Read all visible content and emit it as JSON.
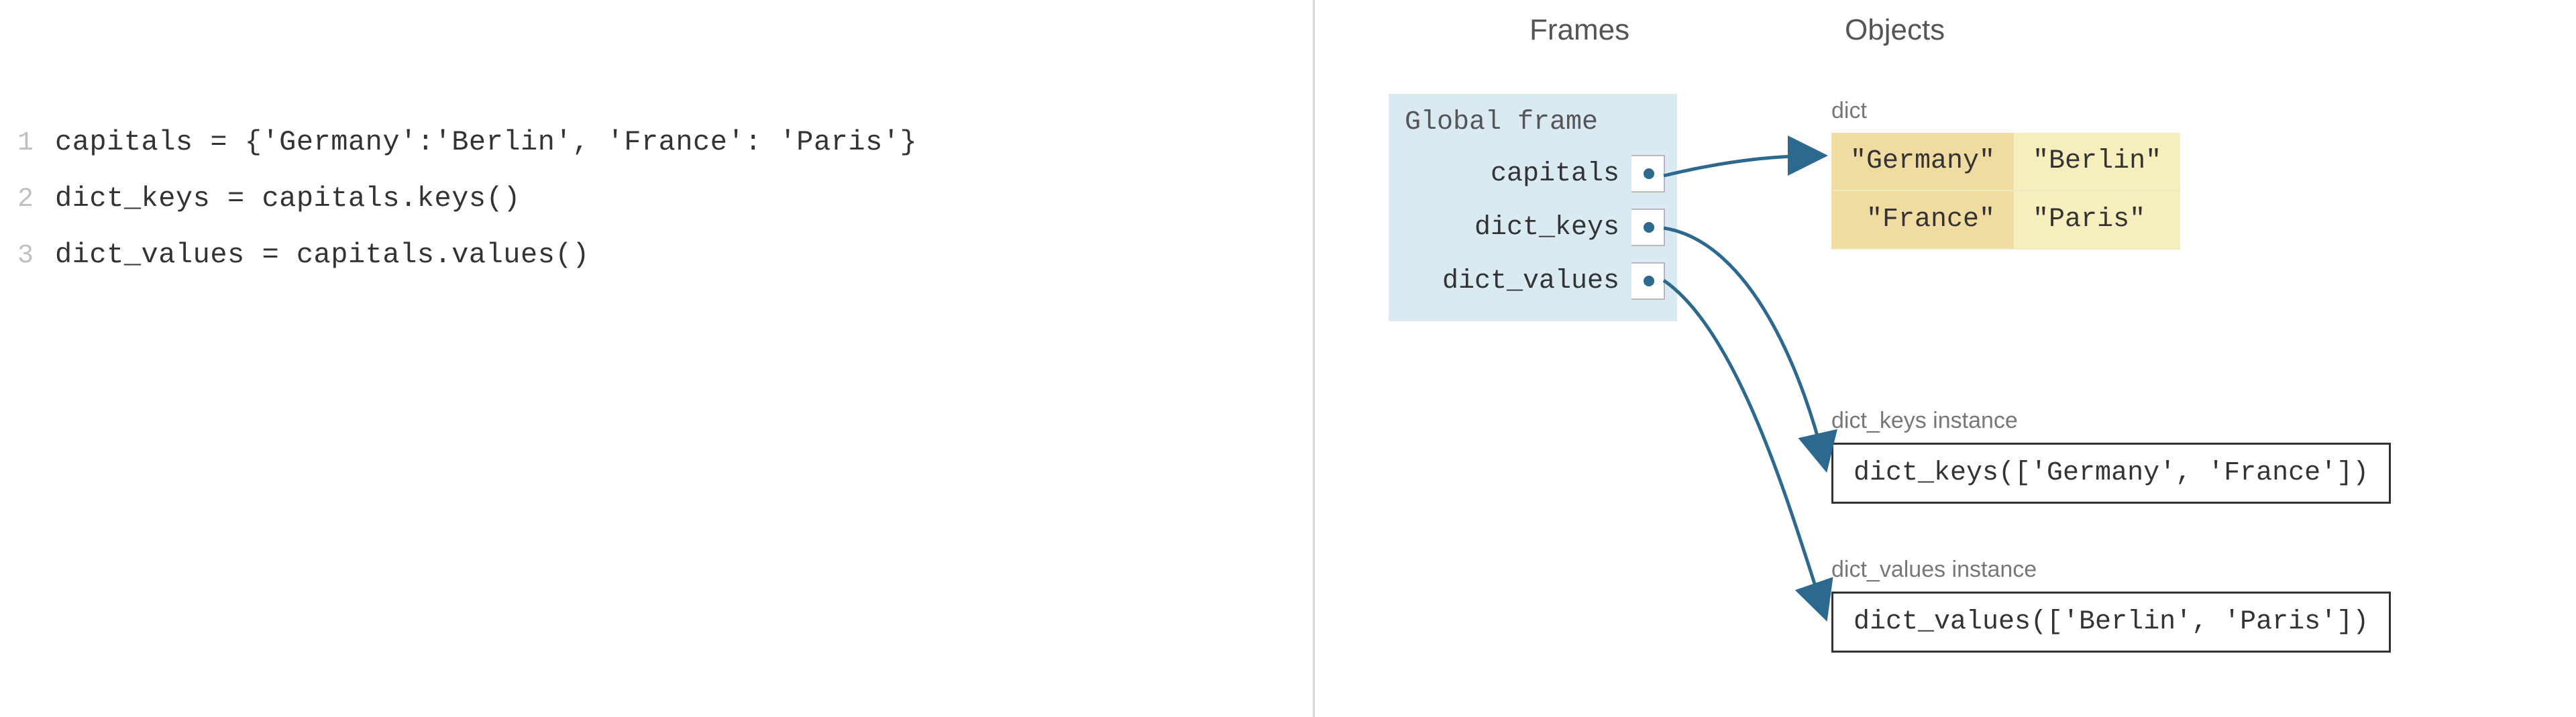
{
  "code": {
    "lines": [
      {
        "n": "1",
        "text": "capitals = {'Germany':'Berlin', 'France': 'Paris'}"
      },
      {
        "n": "2",
        "text": "dict_keys = capitals.keys()"
      },
      {
        "n": "3",
        "text": "dict_values = capitals.values()"
      }
    ]
  },
  "headers": {
    "frames": "Frames",
    "objects": "Objects"
  },
  "frame": {
    "title": "Global frame",
    "vars": [
      "capitals",
      "dict_keys",
      "dict_values"
    ]
  },
  "objects": {
    "dict": {
      "label": "dict",
      "rows": [
        {
          "key": "\"Germany\"",
          "val": "\"Berlin\""
        },
        {
          "key": "\"France\"",
          "val": "\"Paris\""
        }
      ]
    },
    "dict_keys": {
      "label": "dict_keys instance",
      "repr": "dict_keys(['Germany', 'France'])"
    },
    "dict_values": {
      "label": "dict_values instance",
      "repr": "dict_values(['Berlin', 'Paris'])"
    }
  }
}
